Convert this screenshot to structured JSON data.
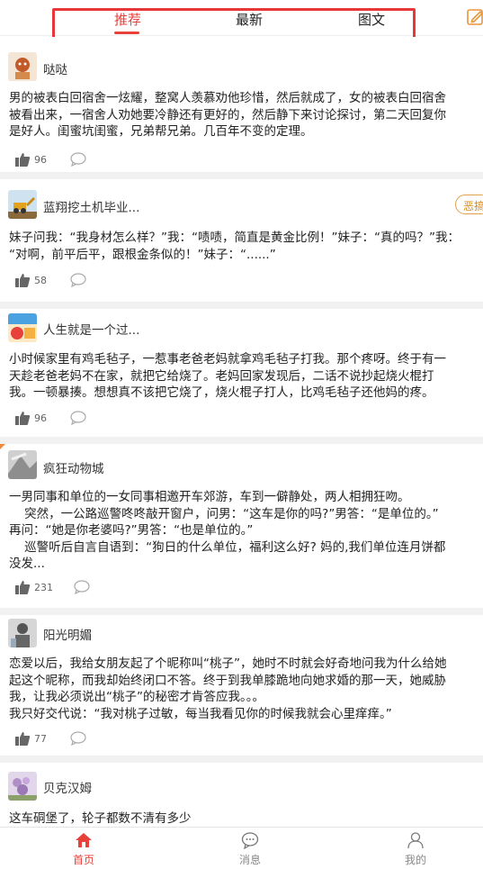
{
  "header": {
    "tabs": [
      {
        "label": "推荐",
        "active": true
      },
      {
        "label": "最新",
        "active": false
      },
      {
        "label": "图文",
        "active": false
      }
    ],
    "edit_icon": "edit-icon",
    "accent_color": "#e8403a"
  },
  "posts": [
    {
      "user": "哒哒",
      "text": "男的被表白回宿舍一炫耀，整窝人羡慕劝他珍惜，然后就成了，女的被表白回宿舍\n被看出来，一宿舍人劝她要冷静还有更好的，然后静下来讨论探讨，第二天回复你\n是好人。闺蜜坑闺蜜，兄弟帮兄弟。几百年不变的定理。",
      "likes": "96"
    },
    {
      "user": "蓝翔挖土机毕业...",
      "badge": "恶搞",
      "text": "妹子问我：“我身材怎么样？”我：“啧啧，简直是黄金比例！”妹子：“真的吗？”我：\n“对啊，前平后平，跟根金条似的！”妹子：“......”",
      "likes": "58"
    },
    {
      "user": "人生就是一个过...",
      "text": "小时候家里有鸡毛毡子，一惹事老爸老妈就拿鸡毛毡子打我。那个疼呀。终于有一\n天趁老爸老妈不在家，就把它给烧了。老妈回家发现后，二话不说抄起烧火棍打\n我。一顿暴揍。想想真不该把它烧了，烧火棍子打人，比鸡毛毡子还他妈的疼。",
      "likes": "96"
    },
    {
      "user": "疯狂动物城",
      "text": "一男同事和单位的一女同事相邀开车郊游，车到一僻静处，两人相拥狂吻。\n    突然，一公路巡警咚咚敲开窗户，问男：“这车是你的吗?”男答：“是单位的。”\n再问：“她是你老婆吗?”男答：“也是单位的。”\n    巡警听后自言自语到：“狗日的什么单位，福利这么好? 妈的,我们单位连月饼都\n没发...",
      "likes": "231"
    },
    {
      "user": "阳光明媚",
      "text": "恋爱以后，我给女朋友起了个昵称叫“桃子”，她时不时就会好奇地问我为什么给她\n起这个昵称，而我却始终闭口不答。终于到我单膝跪地向她求婚的那一天，她威胁\n我，让我必须说出“桃子”的秘密才肯答应我。。。\n我只好交代说：“我对桃子过敏，每当我看见你的时候我就会心里痒痒。”",
      "likes": "77"
    },
    {
      "user": "贝克汉姆",
      "text": "这车硐堡了，轮子都数不清有多少"
    }
  ],
  "bottom_nav": [
    {
      "label": "首页",
      "icon": "home-icon",
      "active": true
    },
    {
      "label": "消息",
      "icon": "message-icon",
      "active": false
    },
    {
      "label": "我的",
      "icon": "profile-icon",
      "active": false
    }
  ]
}
